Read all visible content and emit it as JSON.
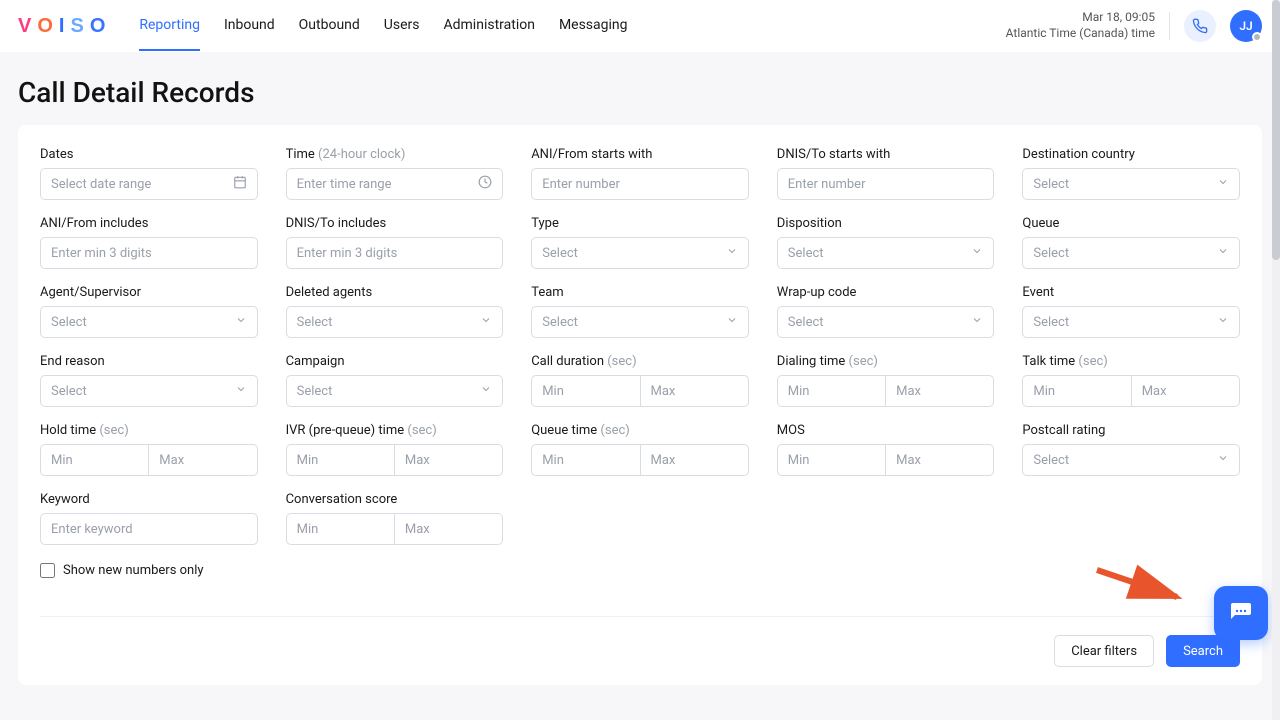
{
  "logo": "VOISO",
  "nav": [
    "Reporting",
    "Inbound",
    "Outbound",
    "Users",
    "Administration",
    "Messaging"
  ],
  "clock": {
    "datetime": "Mar 18, 09:05",
    "tz": "Atlantic Time (Canada) time"
  },
  "avatar_initials": "JJ",
  "page_title": "Call Detail Records",
  "placeholders": {
    "select": "Select",
    "date_range": "Select date range",
    "time_range": "Enter time range",
    "enter_number": "Enter number",
    "min3": "Enter min 3 digits",
    "min": "Min",
    "max": "Max",
    "keyword": "Enter keyword"
  },
  "labels": {
    "dates": "Dates",
    "time": "Time",
    "time_hint": "(24-hour clock)",
    "ani_starts": "ANI/From starts with",
    "dnis_starts": "DNIS/To starts with",
    "dest_country": "Destination country",
    "ani_includes": "ANI/From includes",
    "dnis_includes": "DNIS/To includes",
    "type": "Type",
    "disposition": "Disposition",
    "queue": "Queue",
    "agent": "Agent/Supervisor",
    "deleted_agents": "Deleted agents",
    "team": "Team",
    "wrapup": "Wrap-up code",
    "event": "Event",
    "end_reason": "End reason",
    "campaign": "Campaign",
    "call_duration": "Call duration",
    "dialing_time": "Dialing time",
    "talk_time": "Talk time",
    "hold_time": "Hold time",
    "ivr_time": "IVR (pre-queue) time",
    "queue_time": "Queue time",
    "mos": "MOS",
    "postcall": "Postcall rating",
    "keyword": "Keyword",
    "conv_score": "Conversation score",
    "sec": "(sec)"
  },
  "checkbox_label": "Show new numbers only",
  "buttons": {
    "clear": "Clear filters",
    "search": "Search"
  }
}
